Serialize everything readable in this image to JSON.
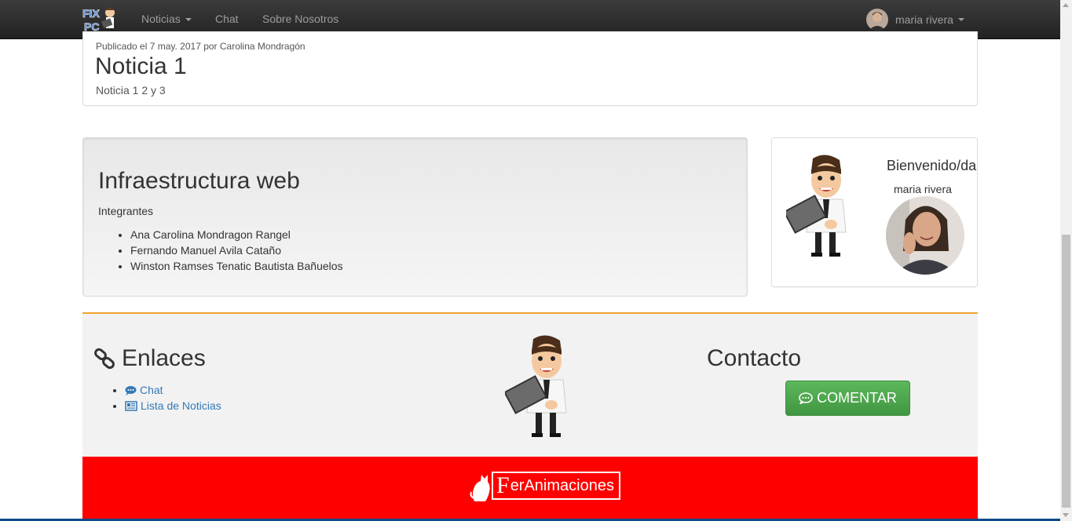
{
  "navbar": {
    "brand_text": "FIX PC",
    "items": [
      {
        "label": "Noticias",
        "has_caret": true
      },
      {
        "label": "Chat"
      },
      {
        "label": "Sobre Nosotros"
      }
    ],
    "user_name": "maria rivera"
  },
  "news": {
    "meta": "Publicado el 7 may. 2017 por Carolina Mondragón",
    "title": "Noticia 1",
    "body": "Noticia 1 2 y 3"
  },
  "jumbotron": {
    "title": "Infraestructura web",
    "subtitle": "Integrantes",
    "members": [
      "Ana Carolina Mondragon Rangel",
      "Fernando Manuel Avila Cataño",
      "Winston Ramses Tenatic Bautista Bañuelos"
    ]
  },
  "welcome": {
    "title": "Bienvenido/da",
    "user_name": "maria rivera"
  },
  "footer": {
    "links_title": "Enlaces",
    "links": [
      {
        "label": "Chat",
        "icon": "comment-icon"
      },
      {
        "label": "Lista de Noticias",
        "icon": "newspaper-icon"
      }
    ],
    "contact_title": "Contacto",
    "comment_button": "COMENTAR",
    "logo_text": "erAnimaciones",
    "logo_letter": "F"
  },
  "colors": {
    "navbar": "#222222",
    "footer_accent": "#f0a42f",
    "red_bar": "#ff0000",
    "button_green": "#5cb85c",
    "link": "#337ab7"
  }
}
